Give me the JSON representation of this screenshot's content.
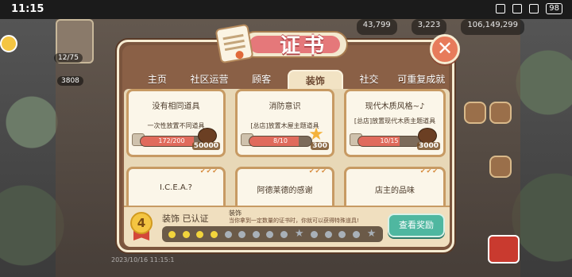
{
  "status_bar": {
    "time": "11:15",
    "battery": "98"
  },
  "hud": {
    "stat1": "43,799",
    "stat2": "3,223",
    "stat3": "106,149,299",
    "level": "12/75",
    "coins": "3808"
  },
  "dialog": {
    "title": "证书",
    "tabs": [
      {
        "label": "主页",
        "active": false
      },
      {
        "label": "社区运营",
        "active": false
      },
      {
        "label": "顾客",
        "active": false
      },
      {
        "label": "装饰",
        "active": true
      },
      {
        "label": "社交",
        "active": false
      },
      {
        "label": "可重复成就",
        "active": false
      }
    ],
    "cards": [
      {
        "name": "没有相同道具",
        "desc": "一次性放置不同道具",
        "progress_text": "172/200",
        "progress": 0.86,
        "reward": "50000",
        "reward_icon": "coffee-bean-icon"
      },
      {
        "name": "消防意识",
        "desc": "[总店]放置木屋主题道具",
        "progress_text": "8/10",
        "progress": 0.8,
        "reward": "300",
        "reward_icon": "star-icon"
      },
      {
        "name": "现代木质风格~♪",
        "desc": "[总店]放置现代木质主题道具",
        "progress_text": "10/15",
        "progress": 0.667,
        "reward": "3000",
        "reward_icon": "coffee-bean-icon"
      },
      {
        "name": "I.C.E.A.?",
        "desc": ""
      },
      {
        "name": "阿德莱德的感谢",
        "desc": ""
      },
      {
        "name": "店主的品味",
        "desc": ""
      }
    ],
    "footer": {
      "medal_level": "4",
      "cert_label": "装饰 已认证",
      "cert_small": "装饰",
      "cert_desc": "当你拿到一定数量的证书时，你就可以获得特殊道具!",
      "progress_filled": 4,
      "progress_total": 15,
      "reward_button": "查看奖励"
    }
  },
  "colors": {
    "accent": "#e5787a",
    "button": "#4fb7a0",
    "panel": "#7b553d"
  }
}
